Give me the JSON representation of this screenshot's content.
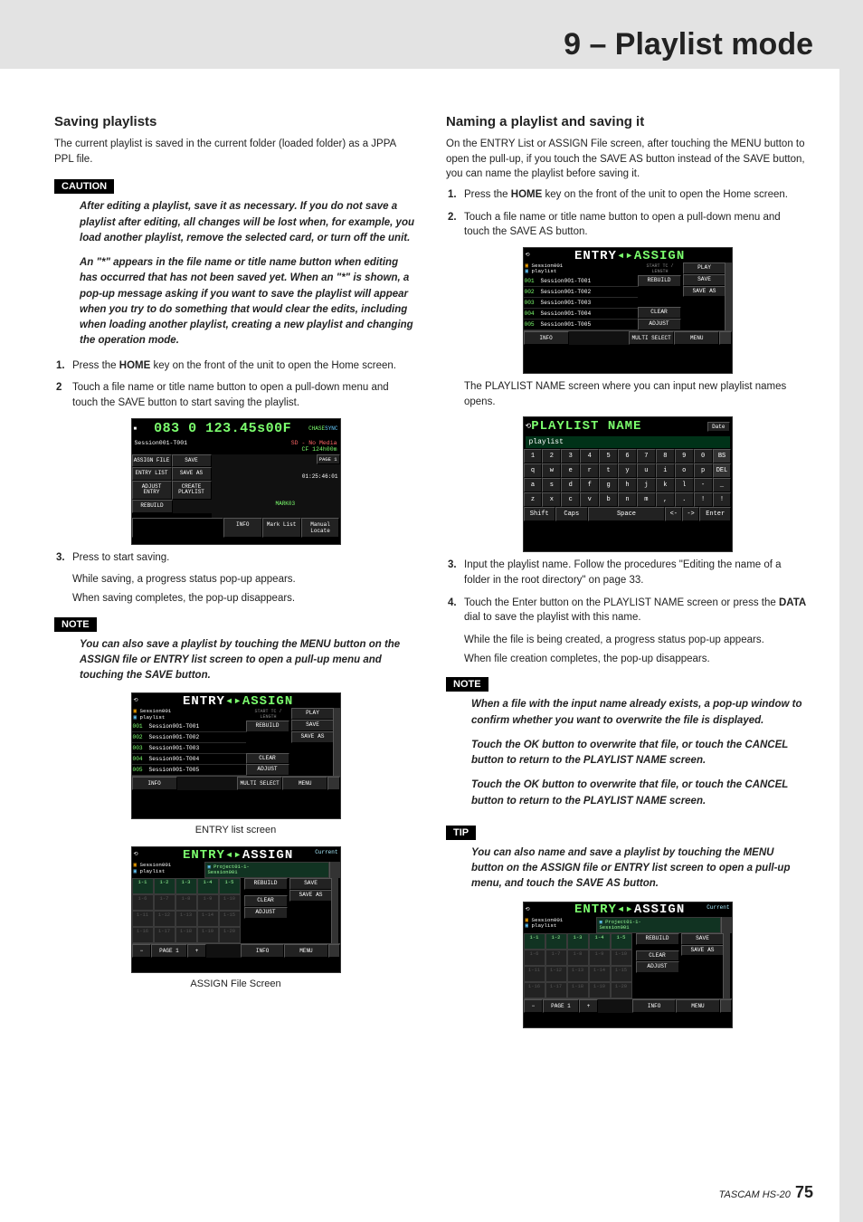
{
  "chapter_title": "9 – Playlist mode",
  "footer": {
    "product": "TASCAM HS-20",
    "page": "75"
  },
  "left": {
    "heading": "Saving playlists",
    "intro": "The current playlist is saved in the current folder (loaded folder) as a JPPA PPL file.",
    "caution_label": "CAUTION",
    "caution1": "After editing a playlist, save it as necessary. If you do not save a playlist after editing, all changes will be lost when, for example, you load another playlist, remove the selected card, or turn off the unit.",
    "caution2": "An \"*\" appears in the file name or title name button when editing has occurred that has not been saved yet. When an \"*\" is shown, a pop-up message asking if you want to save the playlist will appear when you try to do something that would clear the edits, including when loading another playlist, creating a new playlist and changing the operation mode.",
    "step1_pre": "Press the ",
    "step1_bold": "HOME",
    "step1_post": " key on the front of the unit to open the Home screen.",
    "step2": "Touch a file name or title name button to open a pull-down menu and touch the SAVE button to start saving the playlist.",
    "step3": "Press to start saving.",
    "step3_a": "While saving, a progress status pop-up appears.",
    "step3_b": "When saving completes, the pop-up disappears.",
    "note_label": "NOTE",
    "note": "You can also save a playlist by touching the MENU button on the ASSIGN file or ENTRY list screen to open a pull-up menu and touching the SAVE button.",
    "caption1": "ENTRY list screen",
    "caption2": "ASSIGN File Screen"
  },
  "right": {
    "heading": "Naming a playlist and saving it",
    "intro": "On the ENTRY List or ASSIGN File screen, after touching the MENU button to open the pull-up, if you touch the SAVE AS button instead of the SAVE button, you can name the playlist before saving it.",
    "step1_pre": "Press the ",
    "step1_bold": "HOME",
    "step1_post": " key on the front of the unit to open the Home screen.",
    "step2": "Touch a file name or title name button to open a pull-down menu and touch the SAVE AS button.",
    "after_img1": "The PLAYLIST NAME screen where you can input new playlist names opens.",
    "step3": "Input the playlist name. Follow the procedures \"Editing the name of a folder in the root directory\" on page 33.",
    "step4_pre": "Touch the Enter button on the PLAYLIST NAME screen or press the ",
    "step4_bold": "DATA",
    "step4_post": " dial to save the playlist with this name.",
    "step4_a": "While the file is being created, a progress status pop-up appears.",
    "step4_b": "When file creation completes, the pop-up disappears.",
    "note_label": "NOTE",
    "note1": "When a file with the input name already exists, a pop-up window to confirm whether you want to overwrite the file is displayed.",
    "note2": "Touch the OK button to overwrite that file, or touch the CANCEL button to return to the PLAYLIST NAME screen.",
    "note3": "Touch the OK button to overwrite that file, or touch the CANCEL button to return to the PLAYLIST NAME screen.",
    "tip_label": "TIP",
    "tip": "You can also name and save a playlist by touching the MENU button on the ASSIGN file or ENTRY list screen to open a pull-up menu, and touch the SAVE AS button."
  },
  "lcd": {
    "entry_title_left": "ENTRY",
    "entry_title_right": "ASSIGN",
    "assign_title_left": "ENTRY",
    "assign_title_right": "ASSIGN",
    "session": "Session001",
    "playlist": "playlist",
    "play": "PLAY",
    "start_length": "START TC / LENGTH",
    "current": "Current",
    "project": "Project01-1-",
    "project2": "Session001",
    "entries": [
      {
        "n": "001",
        "t": "Session001-T001"
      },
      {
        "n": "002",
        "t": "Session001-T002"
      },
      {
        "n": "003",
        "t": "Session001-T003"
      },
      {
        "n": "004",
        "t": "Session001-T004"
      },
      {
        "n": "005",
        "t": "Session001-T005"
      }
    ],
    "btns": {
      "rebuild": "REBUILD",
      "save": "SAVE",
      "saveas": "SAVE\nAS",
      "clear": "CLEAR",
      "adjust": "ADJUST",
      "info": "INFO",
      "multi": "MULTI\nSELECT",
      "menu": "MENU"
    },
    "home": {
      "timer": "083 0 123.45s00F",
      "sess": "Session001-T001",
      "media": "SD - No Media",
      "cf": "CF  124h00m",
      "assign_file": "ASSIGN\nFILE",
      "save": "SAVE",
      "entry_list": "ENTRY\nLIST",
      "save_as": "SAVE AS",
      "adjust_entry": "ADJUST\nENTRY",
      "create_playlist": "CREATE\nPLAYLIST",
      "rebuild": "REBUILD",
      "tc": "01:25:46:01",
      "mark": "MARK03",
      "info": "INFO",
      "marklist": "Mark\nList",
      "manual": "Manual\nLocate",
      "page": "PAGE\n1"
    },
    "assign": {
      "slots": [
        "1-1",
        "1-2",
        "1-3",
        "1-4",
        "1-5",
        "1-6",
        "1-7",
        "1-8",
        "1-9",
        "1-10",
        "1-11",
        "1-12",
        "1-13",
        "1-14",
        "1-15",
        "1-16",
        "1-17",
        "1-18",
        "1-19",
        "1-20"
      ],
      "minus": "−",
      "page": "PAGE\n1",
      "plus": "+"
    },
    "kbd": {
      "title": "PLAYLIST NAME",
      "date": "Date",
      "value": "playlist",
      "row1": [
        "1",
        "2",
        "3",
        "4",
        "5",
        "6",
        "7",
        "8",
        "9",
        "0",
        "BS"
      ],
      "row2": [
        "q",
        "w",
        "e",
        "r",
        "t",
        "y",
        "u",
        "i",
        "o",
        "p",
        "DEL"
      ],
      "row3": [
        "a",
        "s",
        "d",
        "f",
        "g",
        "h",
        "j",
        "k",
        "l",
        "-",
        "_"
      ],
      "row4": [
        "z",
        "x",
        "c",
        "v",
        "b",
        "n",
        "m",
        ",",
        ".",
        "!",
        "!"
      ],
      "row5": {
        "shift": "Shift",
        "caps": "Caps",
        "space": "Space",
        "l": "<-",
        "r": "->",
        "enter": "Enter"
      }
    }
  }
}
